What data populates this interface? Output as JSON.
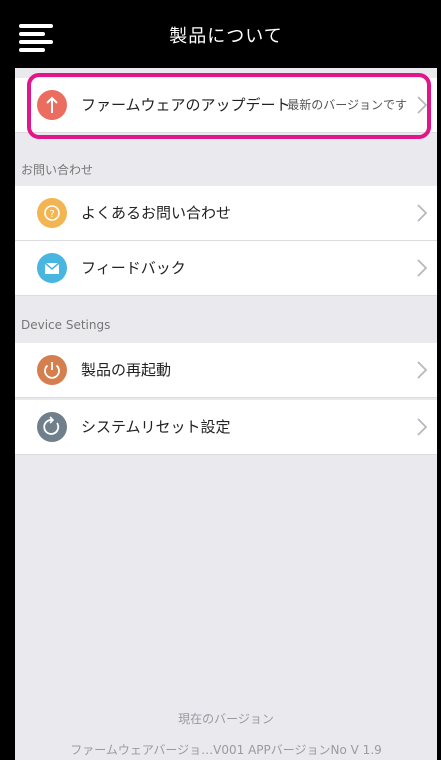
{
  "header": {
    "title": "製品について"
  },
  "rows": {
    "firmware": {
      "label": "ファームウェアのアップデート",
      "value": "最新のバージョンです"
    },
    "faq": {
      "label": "よくあるお問い合わせ"
    },
    "feedback": {
      "label": "フィードバック"
    },
    "restart": {
      "label": "製品の再起動"
    },
    "reset": {
      "label": "システムリセット設定"
    }
  },
  "sections": {
    "contact": "お問い合わせ",
    "device": "Device Setings"
  },
  "footer": {
    "current_version_label": "現在のバージョン",
    "versions": "ファームウェアバージョ…V001  APPバージョンNo V 1.9"
  },
  "icons": {
    "firmware": "upload-arrow-icon",
    "faq": "question-icon",
    "feedback": "mail-icon",
    "restart": "power-icon",
    "reset": "reset-icon",
    "menu": "hamburger-menu-icon",
    "chevron": "chevron-right-icon"
  },
  "colors": {
    "firmware_icon": "#ea6d5f",
    "faq_icon": "#f2b552",
    "feedback_icon": "#48b6e0",
    "restart_icon": "#d67f4e",
    "reset_icon": "#6f7f8c",
    "highlight": "#e0168a",
    "nav_bg": "#000000",
    "page_bg": "#e9e9ee"
  }
}
